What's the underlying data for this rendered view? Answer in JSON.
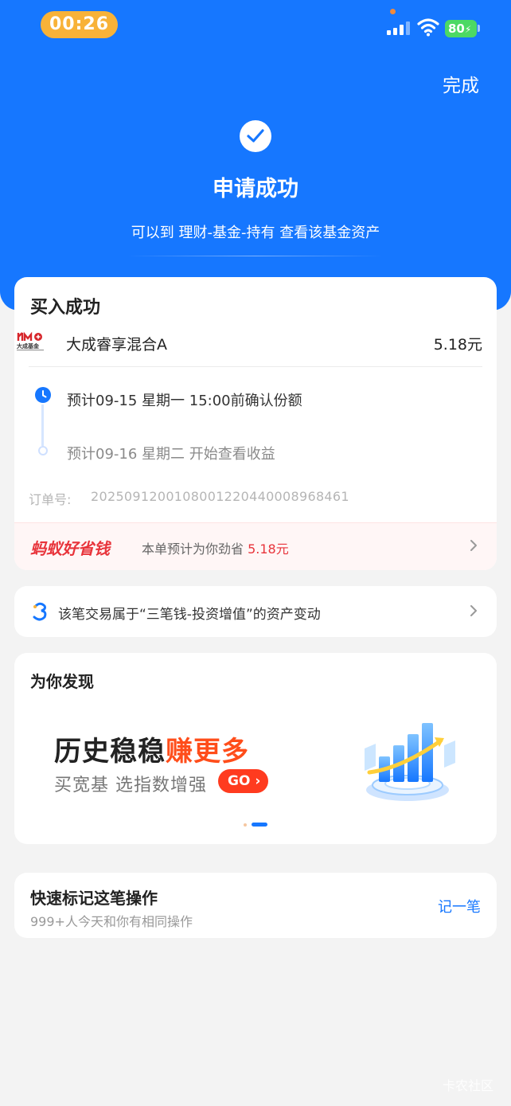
{
  "status_bar": {
    "time": "00:26",
    "battery": "80"
  },
  "header": {
    "done_label": "完成",
    "title": "申请成功",
    "subtitle": "可以到 理财-基金-持有 查看该基金资产"
  },
  "purchase": {
    "title": "买入成功",
    "fund_logo_text": "大成基金",
    "fund_name": "大成睿享混合A",
    "amount": "5.18元",
    "timeline": [
      {
        "text": "预计09-15 星期一 15:00前确认份额"
      },
      {
        "text": "预计09-16 星期二 开始查看收益"
      }
    ],
    "order_label": "订单号:",
    "order_no": "2025091200108001220440008968461",
    "savings": {
      "brand": "蚂蚁好省钱",
      "text": "本单预计为你劲省 ",
      "amount": "5.18元"
    }
  },
  "asset_change": {
    "text": "该笔交易属于“三笔钱-投资增值”的资产变动"
  },
  "discover": {
    "title": "为你发现",
    "banner_head_plain": "历史稳稳",
    "banner_head_highlight": "赚更多",
    "banner_sub": "买宽基 选指数增强",
    "go_label": "GO"
  },
  "quick_mark": {
    "title": "快速标记这笔操作",
    "subtitle": "999+人今天和你有相同操作",
    "action_label": "记一笔"
  },
  "watermark": "卡农社区",
  "colors": {
    "primary": "#1677ff",
    "accent_red": "#e8343b",
    "banner_orange": "#ff4d1a",
    "battery_green": "#4cd964",
    "time_pill": "#f8b238"
  }
}
